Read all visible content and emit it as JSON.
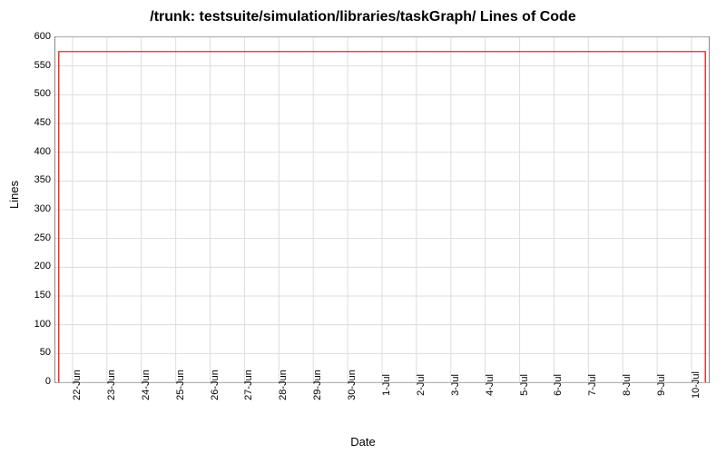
{
  "chart_data": {
    "type": "line",
    "title": "/trunk: testsuite/simulation/libraries/taskGraph/ Lines of Code",
    "xlabel": "Date",
    "ylabel": "Lines",
    "ylim": [
      0,
      600
    ],
    "y_ticks": [
      0,
      50,
      100,
      150,
      200,
      250,
      300,
      350,
      400,
      450,
      500,
      550,
      600
    ],
    "categories": [
      "22-Jun",
      "23-Jun",
      "24-Jun",
      "25-Jun",
      "26-Jun",
      "27-Jun",
      "28-Jun",
      "29-Jun",
      "30-Jun",
      "1-Jul",
      "2-Jul",
      "3-Jul",
      "4-Jul",
      "5-Jul",
      "6-Jul",
      "7-Jul",
      "8-Jul",
      "9-Jul",
      "10-Jul"
    ],
    "x": [
      0,
      1,
      2,
      3,
      4,
      5,
      6,
      7,
      8,
      9,
      10,
      11,
      12,
      13,
      14,
      15,
      16,
      17,
      18
    ],
    "series": [
      {
        "name": "Lines of Code",
        "color": "#ff0000",
        "points": [
          {
            "x": -0.4,
            "y": 0
          },
          {
            "x": -0.4,
            "y": 575
          },
          {
            "x": 18.4,
            "y": 575
          },
          {
            "x": 18.4,
            "y": 0
          }
        ]
      }
    ],
    "grid": true
  }
}
